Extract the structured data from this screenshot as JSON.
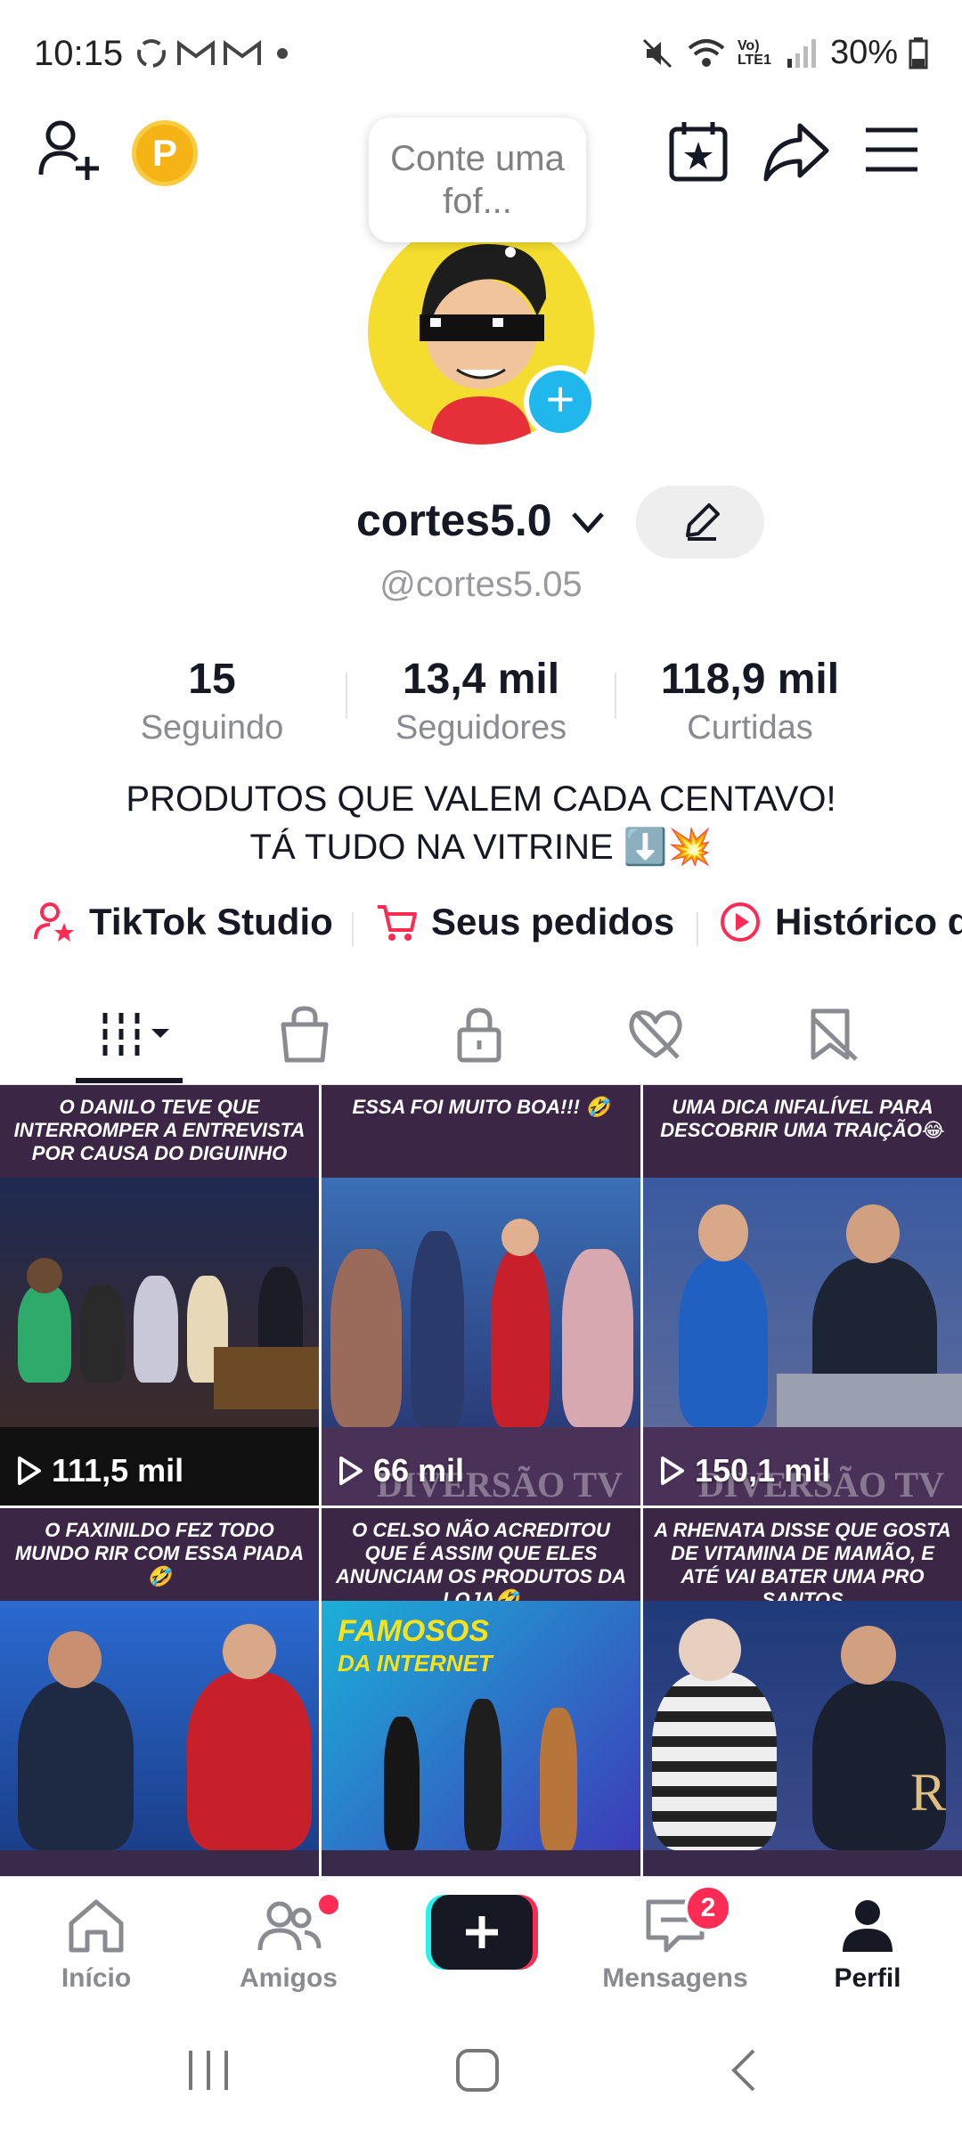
{
  "status_bar": {
    "time": "10:15",
    "notification_icons": [
      "sync-icon",
      "gmail-icon",
      "gmail-icon",
      "dot-icon"
    ],
    "battery": "30%",
    "network": "Vo) LTE1"
  },
  "topbar": {
    "coin_label": "P"
  },
  "profile": {
    "note_text": "Conte uma fof...",
    "display_name": "cortes5.0",
    "handle": "@cortes5.05",
    "bio_line1": "PRODUTOS QUE VALEM CADA CENTAVO!",
    "bio_line2": "TÁ TUDO NA VITRINE ⬇️💥"
  },
  "stats": [
    {
      "value": "15",
      "label": "Seguindo"
    },
    {
      "value": "13,4 mil",
      "label": "Seguidores"
    },
    {
      "value": "118,9 mil",
      "label": "Curtidas"
    }
  ],
  "links": [
    {
      "label": "TikTok Studio",
      "icon": "person-star-icon"
    },
    {
      "label": "Seus pedidos",
      "icon": "cart-icon"
    },
    {
      "label": "Histórico d",
      "icon": "play-circle-icon"
    }
  ],
  "tabs": [
    {
      "icon": "grid-icon",
      "active": true
    },
    {
      "icon": "bag-icon"
    },
    {
      "icon": "lock-icon"
    },
    {
      "icon": "heart-hidden-icon"
    },
    {
      "icon": "bookmark-hidden-icon"
    }
  ],
  "videos": [
    {
      "caption": "O DANILO TEVE QUE INTERROMPER A ENTREVISTA POR CAUSA DO DIGUINHO",
      "views": "111,5 mil"
    },
    {
      "caption": "ESSA FOI MUITO BOA!!! 🤣",
      "views": "66 mil"
    },
    {
      "caption": "UMA DICA INFALÍVEL PARA DESCOBRIR UMA TRAIÇÃO😂",
      "views": "150,1 mil"
    },
    {
      "caption": "O FAXINILDO FEZ TODO MUNDO RIR COM ESSA PIADA 🤣",
      "views": ""
    },
    {
      "caption": "O CELSO NÃO ACREDITOU QUE É ASSIM QUE ELES ANUNCIAM OS PRODUTOS DA LOJA🤣",
      "views": ""
    },
    {
      "caption": "A RHENATA DISSE QUE GOSTA DE VITAMINA DE MAMÃO, E ATÉ VAI BATER UMA PRO SANTOS",
      "views": ""
    }
  ],
  "video_overlay_text": {
    "watermark": "DIVERSÃO TV",
    "famosos": "FAMOSOS",
    "da_internet": "DA INTERNET"
  },
  "bottom_nav": {
    "home": "Início",
    "friends": "Amigos",
    "messages": "Mensagens",
    "messages_badge": "2",
    "profile": "Perfil"
  },
  "colors": {
    "accent": "#fe2c55",
    "cyan": "#25f4ee",
    "text": "#161823",
    "muted": "#8a8b91"
  }
}
